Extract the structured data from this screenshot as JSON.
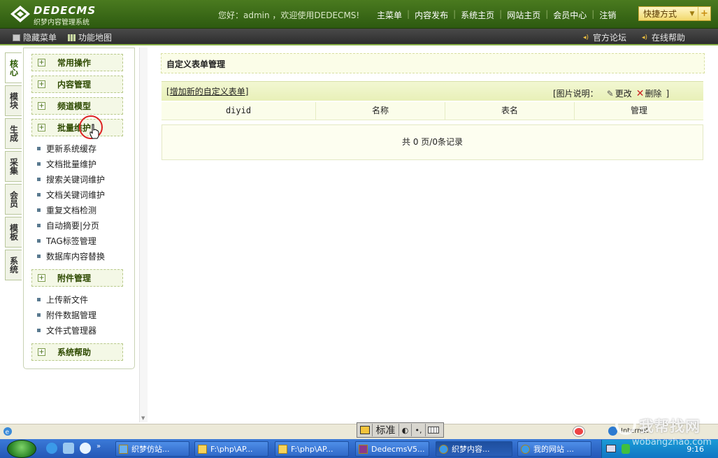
{
  "header": {
    "logo_title": "DEDECMS",
    "logo_subtitle": "织梦内容管理系统",
    "welcome": "您好：admin ，欢迎使用DEDECMS!",
    "nav": [
      "主菜单",
      "内容发布",
      "系统主页",
      "网站主页",
      "会员中心",
      "注销"
    ],
    "quick_label": "快捷方式",
    "quick_plus": "+"
  },
  "subbar": {
    "hide_menu": "隐藏菜单",
    "site_map": "功能地图",
    "forum": "官方论坛",
    "help": "在线帮助"
  },
  "side_tabs": [
    {
      "label": "核心",
      "active": true
    },
    {
      "label": "模块",
      "active": false
    },
    {
      "label": "生成",
      "active": false
    },
    {
      "label": "采集",
      "active": false
    },
    {
      "label": "会员",
      "active": false
    },
    {
      "label": "模板",
      "active": false
    },
    {
      "label": "系统",
      "active": false
    }
  ],
  "menu": {
    "groups": [
      "常用操作",
      "内容管理",
      "频道模型",
      "批量维护",
      "附件管理",
      "系统帮助"
    ],
    "batch_items": [
      "更新系统缓存",
      "文档批量维护",
      "搜索关键词维护",
      "文档关键词维护",
      "重复文档检测",
      "自动摘要|分页",
      "TAG标签管理",
      "数据库内容替换"
    ],
    "attach_items": [
      "上传新文件",
      "附件数据管理",
      "文件式管理器"
    ]
  },
  "main": {
    "title": "自定义表单管理",
    "add_link": "增加新的自定义表单",
    "legend_label": "[图片说明：",
    "legend_edit": "更改",
    "legend_delete": "删除",
    "legend_close": "]",
    "columns": [
      "diyid",
      "名称",
      "表名",
      "管理"
    ],
    "empty_text": "共 0 页/0条记录"
  },
  "statusbar": {
    "ime_mode": "标准",
    "zone": "Internet"
  },
  "taskbar": {
    "items": [
      "织梦仿站...",
      "F:\\php\\AP...",
      "F:\\php\\AP...",
      "DedecmsV5...",
      "织梦内容...",
      "我的网站 ..."
    ],
    "clock": "9:16"
  },
  "watermark": {
    "big": "我帮找网",
    "small": "wobangzhao.com"
  },
  "colors": {
    "header_green": "#3d6d18",
    "accent_yellow": "#f1d86c",
    "panel_bg": "#fbfde8"
  }
}
